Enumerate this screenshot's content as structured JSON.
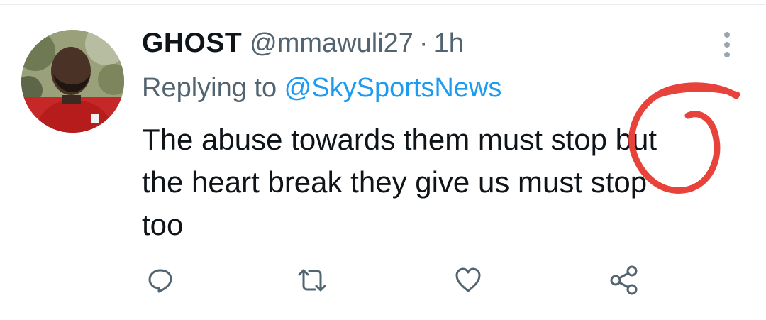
{
  "tweet": {
    "display_name": "GHOST",
    "handle": "@mmawuli27",
    "separator": "·",
    "time": "1h",
    "replying_prefix": "Replying to ",
    "replying_to": "@SkySportsNews",
    "text_lines": [
      "The abuse towards them must stop but",
      "the heart break they give us must stop",
      "too"
    ]
  },
  "icons": {
    "more": "more-vertical-icon",
    "reply": "reply-icon",
    "retweet": "retweet-icon",
    "like": "heart-icon",
    "share": "share-icon"
  },
  "colors": {
    "text": "#0f1419",
    "secondary": "#536471",
    "link": "#1d9bf0",
    "annotation": "#e8433a",
    "divider": "#e6ecf0"
  }
}
